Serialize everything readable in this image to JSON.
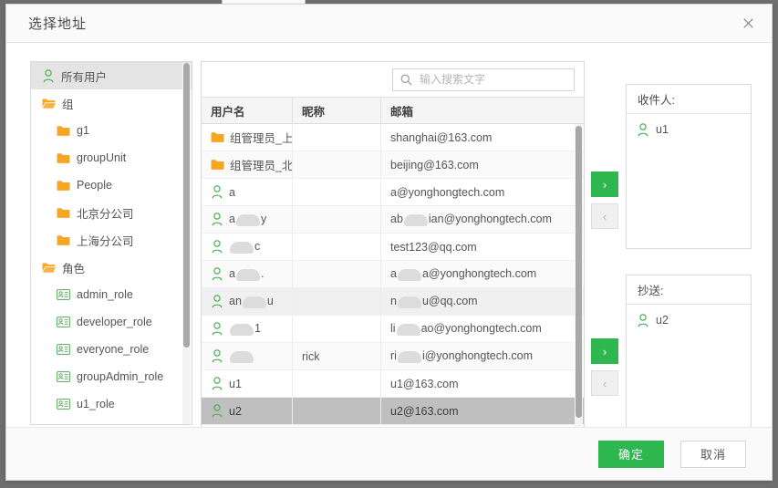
{
  "ghost": {
    "text": ""
  },
  "dialog": {
    "title": "选择地址",
    "close_icon": "close-icon"
  },
  "tree": {
    "items": [
      {
        "label": "所有用户",
        "icon": "person-icon",
        "level": 1,
        "selected": true
      },
      {
        "label": "组",
        "icon": "folder-open-icon",
        "level": 1,
        "selected": false
      },
      {
        "label": "g1",
        "icon": "folder-icon",
        "level": 2,
        "selected": false
      },
      {
        "label": "groupUnit",
        "icon": "folder-icon",
        "level": 2,
        "selected": false
      },
      {
        "label": "People",
        "icon": "folder-icon",
        "level": 2,
        "selected": false
      },
      {
        "label": "北京分公司",
        "icon": "folder-icon",
        "level": 2,
        "selected": false
      },
      {
        "label": "上海分公司",
        "icon": "folder-icon",
        "level": 2,
        "selected": false
      },
      {
        "label": "角色",
        "icon": "folder-open-icon",
        "level": 1,
        "selected": false
      },
      {
        "label": "admin_role",
        "icon": "role-card-icon",
        "level": 2,
        "selected": false
      },
      {
        "label": "developer_role",
        "icon": "role-card-icon",
        "level": 2,
        "selected": false
      },
      {
        "label": "everyone_role",
        "icon": "role-card-icon",
        "level": 2,
        "selected": false
      },
      {
        "label": "groupAdmin_role",
        "icon": "role-card-icon",
        "level": 2,
        "selected": false
      },
      {
        "label": "u1_role",
        "icon": "role-card-icon",
        "level": 2,
        "selected": false
      }
    ]
  },
  "search": {
    "placeholder": "输入搜索文字",
    "value": "",
    "icon": "search-icon"
  },
  "table": {
    "columns": [
      "用户名",
      "昵称",
      "邮箱"
    ],
    "rows": [
      {
        "icon": "folder-icon",
        "user": "组管理员_上海",
        "user_redacted": false,
        "nick": "",
        "mail": "shanghai@163.com",
        "mail_redacted": false,
        "state": "normal"
      },
      {
        "icon": "folder-icon",
        "user": "组管理员_北京",
        "user_redacted": false,
        "nick": "",
        "mail": "beijing@163.com",
        "mail_redacted": false,
        "state": "alt"
      },
      {
        "icon": "person-icon",
        "user": "a",
        "user_redacted": false,
        "nick": "",
        "mail": "a@yonghongtech.com",
        "mail_redacted": false,
        "state": "normal"
      },
      {
        "icon": "person-icon",
        "user": "a…y",
        "user_redacted": true,
        "nick": "",
        "mail": "ab…ian@yonghongtech.com",
        "mail_redacted": true,
        "state": "alt"
      },
      {
        "icon": "person-icon",
        "user": "…c",
        "user_redacted": true,
        "nick": "",
        "mail": "test123@qq.com",
        "mail_redacted": false,
        "state": "normal"
      },
      {
        "icon": "person-icon",
        "user": "a….",
        "user_redacted": true,
        "nick": "",
        "mail": "a…a@yonghongtech.com",
        "mail_redacted": true,
        "state": "alt"
      },
      {
        "icon": "person-icon",
        "user": "an…u",
        "user_redacted": true,
        "nick": "",
        "mail": "n…u@qq.com",
        "mail_redacted": true,
        "state": "hovered"
      },
      {
        "icon": "person-icon",
        "user": "…1",
        "user_redacted": true,
        "nick": "",
        "mail": "li…ao@yonghongtech.com",
        "mail_redacted": true,
        "state": "normal"
      },
      {
        "icon": "person-icon",
        "user": "…",
        "user_redacted": true,
        "nick": "rick",
        "mail": "ri…i@yonghongtech.com",
        "mail_redacted": true,
        "state": "alt"
      },
      {
        "icon": "person-icon",
        "user": "u1",
        "user_redacted": false,
        "nick": "",
        "mail": "u1@163.com",
        "mail_redacted": false,
        "state": "normal"
      },
      {
        "icon": "person-icon",
        "user": "u2",
        "user_redacted": false,
        "nick": "",
        "mail": "u2@163.com",
        "mail_redacted": false,
        "state": "selected"
      }
    ]
  },
  "transfer": {
    "add_label": "›",
    "remove_label": "‹"
  },
  "recipients": {
    "title": "收件人:",
    "items": [
      {
        "label": "u1",
        "icon": "person-icon"
      }
    ]
  },
  "cc": {
    "title": "抄送:",
    "items": [
      {
        "label": "u2",
        "icon": "person-icon"
      }
    ]
  },
  "footer": {
    "confirm_label": "确定",
    "cancel_label": "取消"
  },
  "colors": {
    "accent_green": "#2fb74f",
    "folder_orange": "#f5a623",
    "person_green": "#4caf50",
    "selected_row": "#bfbfbf",
    "header_bg": "#f5f5f5"
  }
}
